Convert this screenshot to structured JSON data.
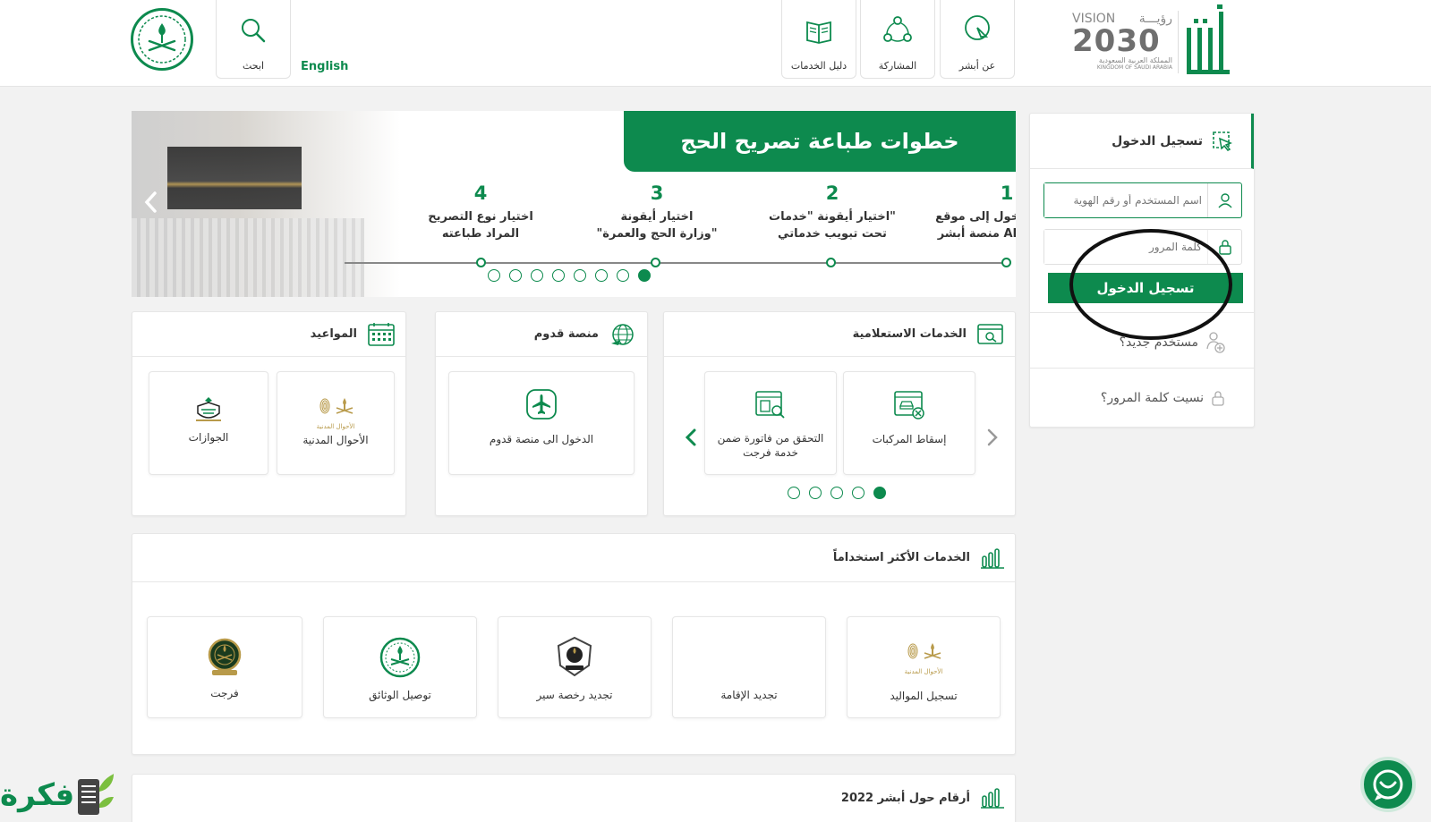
{
  "header": {
    "nav": [
      {
        "label": "عن أبشر",
        "icon": "about-icon"
      },
      {
        "label": "المشاركة",
        "icon": "share-icon"
      },
      {
        "label": "دليل الخدمات",
        "icon": "book-icon"
      }
    ],
    "search_label": "ابحث",
    "language": "English",
    "vision": {
      "vision": "VISION",
      "ruya": "رؤيـــة",
      "year": "2030",
      "kingdom_ar": "المملكة العربية السعودية",
      "kingdom_en": "KINGDOM OF SAUDI ARABIA"
    },
    "logo": "أبشر"
  },
  "login": {
    "title": "تسجيل الدخول",
    "username_placeholder": "اسم المستخدم أو رقم الهوية",
    "password_placeholder": "كلمة المرور",
    "submit": "تسجيل الدخول",
    "new_user": "مستخدم جديد؟",
    "forgot": "نسيت كلمة المرور؟"
  },
  "banner": {
    "title": "خطوات طباعة تصريح الحج",
    "steps": [
      {
        "num": "1",
        "line1": "تسجيل الدخول إلى موقع",
        "line2": "منصة أبشر ABSHER.sa"
      },
      {
        "num": "2",
        "line1": "اختيار أيقونة \"خدمات\"",
        "line2": "تحت تبويب خدماتي"
      },
      {
        "num": "3",
        "line1": "اختيار أيقونة",
        "line2": "\"وزارة الحج والعمرة\""
      },
      {
        "num": "4",
        "line1": "اختيار نوع التصريح",
        "line2": "المراد طباعته"
      }
    ],
    "slides": 8,
    "active_slide": 0
  },
  "inquiry": {
    "title": "الخدمات الاستعلامية",
    "tiles": [
      "إسقاط المركبات",
      "التحقق من فاتورة ضمن خدمة فرجت"
    ],
    "pages": 5,
    "active_page": 0
  },
  "arrival": {
    "title": "منصة قدوم",
    "tile": "الدخول الى منصة قدوم"
  },
  "appointments": {
    "title": "المواعيد",
    "tiles": [
      "الأحوال المدنية",
      "الجوازات"
    ],
    "civil_logo_text": "الأحوال المدنية"
  },
  "most_used": {
    "title": "الخدمات الأكثر استخداماً",
    "tiles": [
      "تسجيل المواليد",
      "تجديد الإقامة",
      "تجديد رخصة سير",
      "توصيل الوثائق",
      "فرجت"
    ],
    "civil_logo_text": "الأحوال المدنية"
  },
  "stats": {
    "title": "أرقام حول أبشر 2022"
  },
  "watermark": {
    "text": "فكرة"
  },
  "colors": {
    "brand": "#0d8a4e",
    "brand_dark": "#0a7a44"
  }
}
